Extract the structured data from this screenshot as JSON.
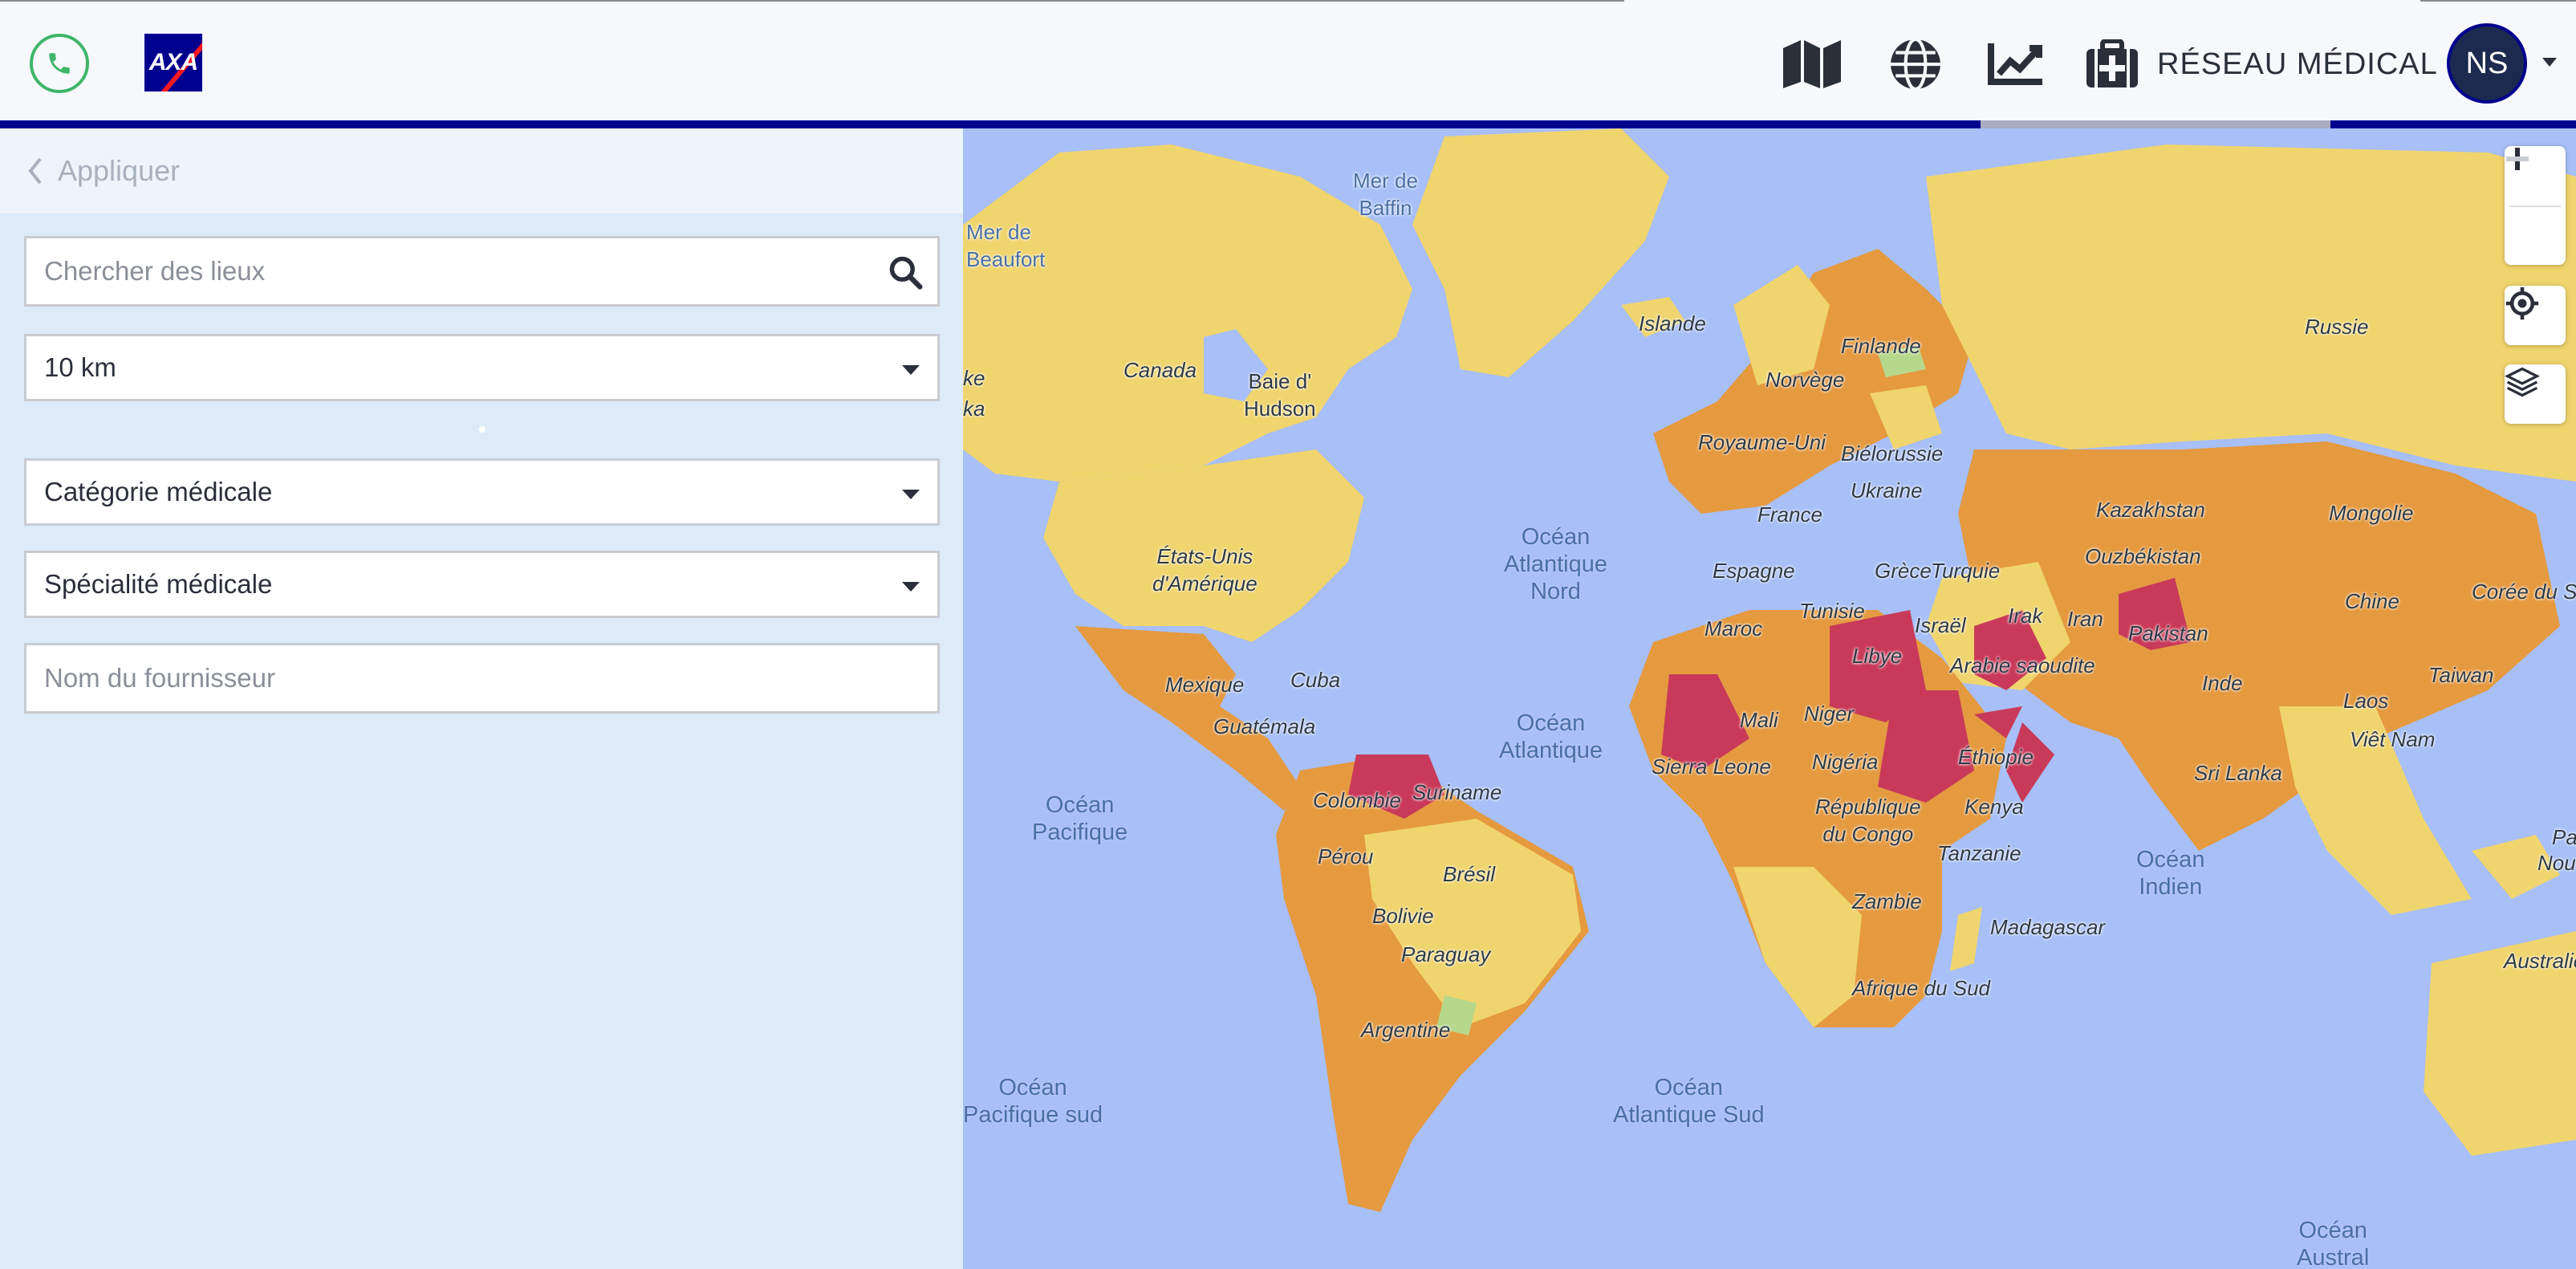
{
  "header": {
    "phone_icon": "phone-icon",
    "logo_text": "AXA",
    "nav_icons": [
      "map-icon",
      "globe-icon",
      "chart-line-icon"
    ],
    "medical_network_label": "RÉSEAU MÉDICAL",
    "medical_network_icon": "medical-kit-icon",
    "avatar_initials": "NS",
    "colors": {
      "accent": "#00008f",
      "phone": "#3fb66a",
      "avatar_bg": "#1b2a4e"
    }
  },
  "sidebar": {
    "apply_label": "Appliquer",
    "search": {
      "placeholder": "Chercher des lieux",
      "icon": "search-icon"
    },
    "radius": {
      "value": "10 km"
    },
    "category": {
      "value": "Catégorie médicale"
    },
    "specialty": {
      "value": "Spécialité médicale"
    },
    "provider": {
      "placeholder": "Nom du fournisseur"
    }
  },
  "map": {
    "controls": [
      "zoom-in",
      "zoom-out",
      "locate",
      "layers"
    ],
    "risk_colors": {
      "low": "#b6d88a",
      "medium": "#f0d46e",
      "high": "#e59a40",
      "extreme": "#c93a5a"
    },
    "labels": {
      "mer_beaufort": "Mer de\nBeaufort",
      "mer_baffin": "Mer de\nBaffin",
      "canada": "Canada",
      "baie_hudson": "Baie d'\nHudson",
      "etats_unis": "États-Unis\nd'Amérique",
      "mexique": "Mexique",
      "cuba": "Cuba",
      "guatemala": "Guatémala",
      "colombie": "Colombie",
      "suriname": "Suriname",
      "perou": "Pérou",
      "bresil": "Brésil",
      "bolivie": "Bolivie",
      "paraguay": "Paraguay",
      "argentine": "Argentine",
      "islande": "Islande",
      "finlande": "Finlande",
      "norvege": "Norvège",
      "royaume_uni": "Royaume-Uni",
      "bielorussie": "Biélorussie",
      "ukraine": "Ukraine",
      "france": "France",
      "espagne": "Espagne",
      "grece": "Grèce",
      "turquie": "Turquie",
      "maroc": "Maroc",
      "tunisie": "Tunisie",
      "libye": "Libye",
      "israel": "Israël",
      "irak": "Irak",
      "iran": "Iran",
      "arabie": "Arabie saoudite",
      "mali": "Mali",
      "niger": "Niger",
      "nigeria": "Nigéria",
      "sierra": "Sierra Leone",
      "ethiopie": "Éthiopie",
      "kenya": "Kenya",
      "rdc": "République\ndu Congo",
      "tanzanie": "Tanzanie",
      "zambie": "Zambie",
      "madagascar": "Madagascar",
      "afrique_sud": "Afrique du Sud",
      "russie": "Russie",
      "kazakhstan": "Kazakhstan",
      "ouzbekistan": "Ouzbékistan",
      "mongolie": "Mongolie",
      "chine": "Chine",
      "pakistan": "Pakistan",
      "inde": "Inde",
      "coree": "Corée du Sud",
      "taiwan": "Taiwan",
      "laos": "Laos",
      "vietnam": "Viêt Nam",
      "srilanka": "Sri Lanka",
      "australie": "Australie",
      "pap": "Pap",
      "nouve": "Nouve",
      "ka": "ka",
      "ke": "ke"
    },
    "oceans": {
      "atl_nord": "Océan\nAtlantique\nNord",
      "atlantique": "Océan\nAtlantique",
      "pacifique": "Océan\nPacifique",
      "pacifique_sud": "Océan\nPacifique sud",
      "atl_sud": "Océan\nAtlantique Sud",
      "indien": "Océan\nIndien",
      "austral": "Océan\nAustral"
    }
  }
}
